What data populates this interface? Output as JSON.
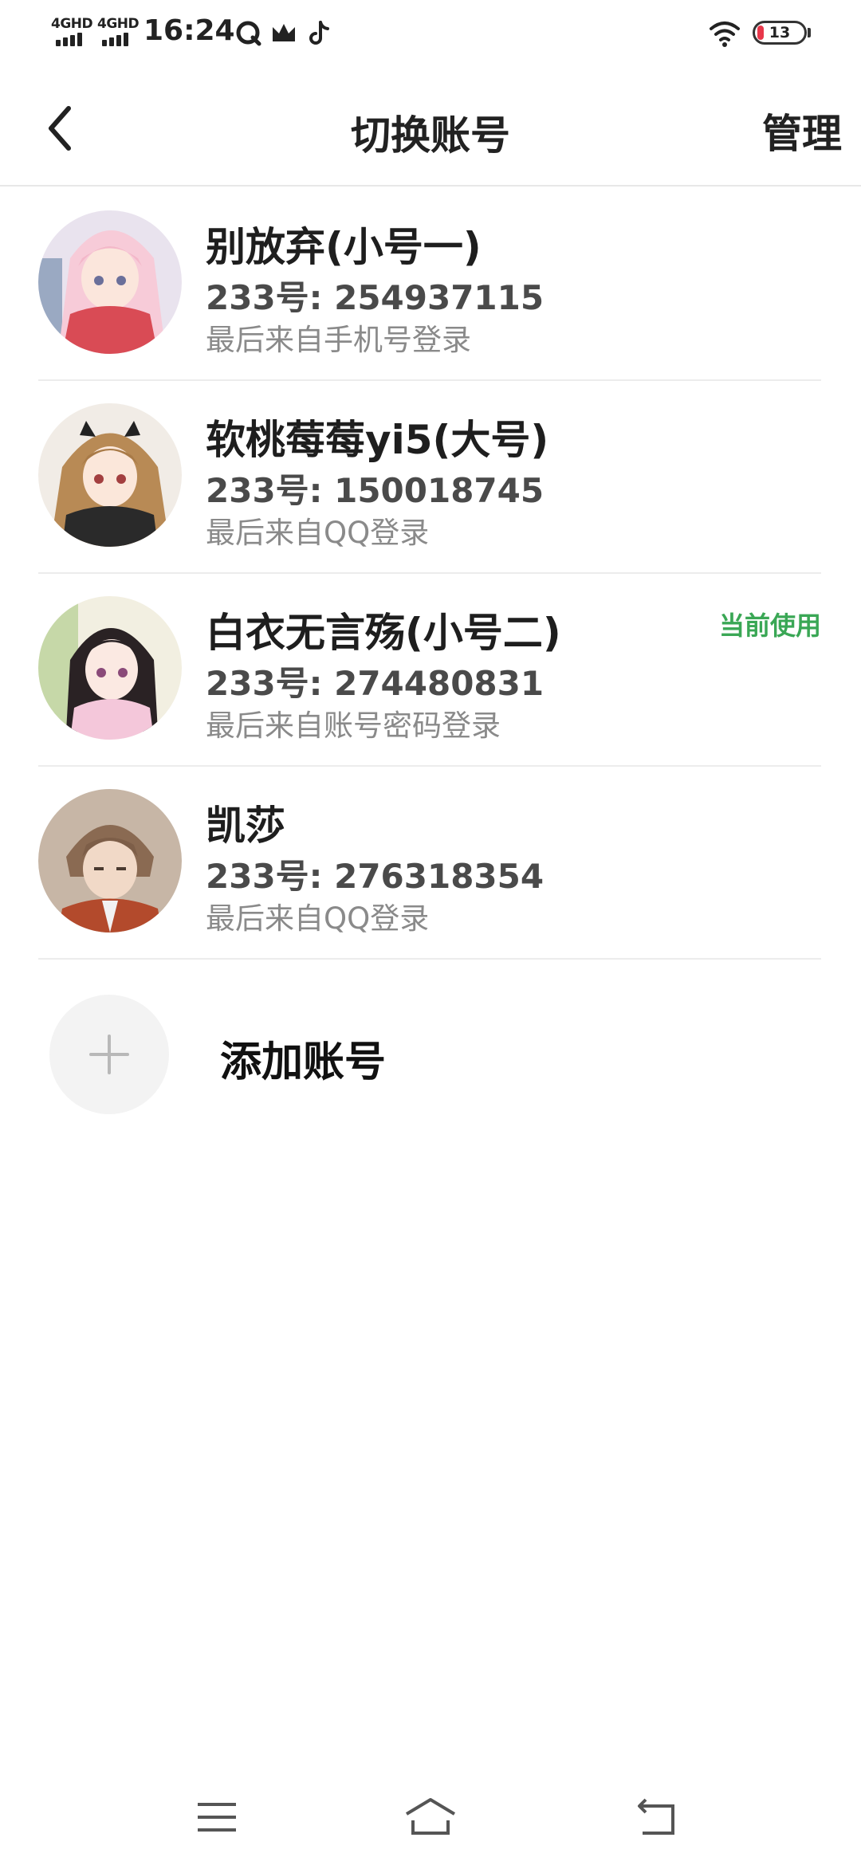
{
  "status_bar": {
    "network_1": "4GHD",
    "network_2": "4GHD",
    "time": "16:24",
    "battery": "13",
    "icons": [
      "q-app-icon",
      "crown-icon",
      "tiktok-icon",
      "wifi-icon",
      "battery-icon"
    ]
  },
  "nav": {
    "title": "切换账号",
    "manage": "管理",
    "back_icon": "chevron-left-icon"
  },
  "accounts": [
    {
      "name": "别放弃(小号一)",
      "uid": "233号: 254937115",
      "login": "最后来自手机号登录",
      "current": ""
    },
    {
      "name": "软桃莓莓yi5(大号)",
      "uid": "233号: 150018745",
      "login": "最后来自QQ登录",
      "current": ""
    },
    {
      "name": "白衣无言殇(小号二)",
      "uid": "233号: 274480831",
      "login": "最后来自账号密码登录",
      "current": "当前使用"
    },
    {
      "name": "凯莎",
      "uid": "233号: 276318354",
      "login": "最后来自QQ登录",
      "current": ""
    }
  ],
  "add_account": {
    "label": "添加账号",
    "icon": "plus-icon"
  },
  "colors": {
    "current_green": "#3aa755",
    "battery_red": "#e8374a"
  },
  "bottom_nav": [
    "menu-icon",
    "home-icon",
    "back-icon"
  ]
}
